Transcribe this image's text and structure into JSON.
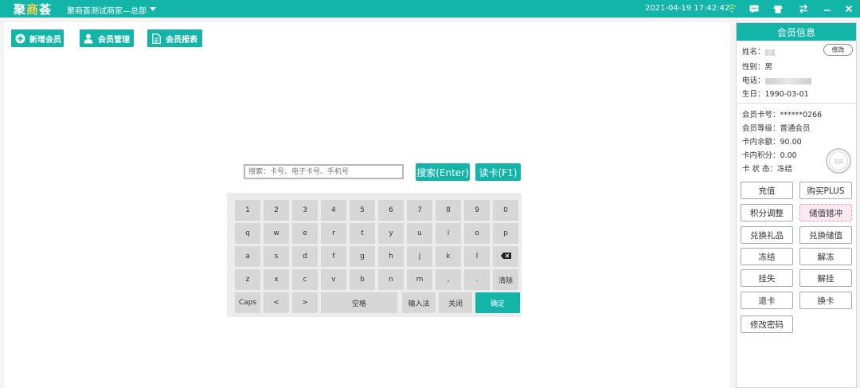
{
  "titlebar": {
    "logo_a": "聚",
    "logo_b": "商",
    "logo_c": "荟",
    "store_name": "聚商荟测试商家—总部",
    "datetime": "2021-04-19 17:42:42",
    "icons": [
      "wifi-icon",
      "message-icon",
      "shirt-icon",
      "swap-icon",
      "minimize-icon",
      "close-icon"
    ],
    "accent_color": "#13b5a8"
  },
  "toolbar": {
    "add_member": "新增会员",
    "member_manage": "会员管理",
    "member_report": "会员报表"
  },
  "search": {
    "placeholder": "搜索：卡号、电子卡号、手机号",
    "search_btn": "搜索(Enter)",
    "read_card_btn": "读卡(F1)"
  },
  "keyboard": {
    "row1": [
      "1",
      "2",
      "3",
      "4",
      "5",
      "6",
      "7",
      "8",
      "9",
      "0"
    ],
    "row2": [
      "q",
      "w",
      "e",
      "r",
      "t",
      "y",
      "u",
      "i",
      "o",
      "p"
    ],
    "row3": [
      "a",
      "s",
      "d",
      "f",
      "g",
      "h",
      "j",
      "k",
      "l"
    ],
    "row4": [
      "z",
      "x",
      "c",
      "v",
      "b",
      "n",
      "m",
      ",",
      ".",
      "清除"
    ],
    "row5": [
      "Caps",
      "<",
      ">",
      "空格",
      "输入法",
      "关闭",
      "确定"
    ]
  },
  "member": {
    "panel_title": "会员信息",
    "name_label": "姓名：",
    "edit_btn": "修改",
    "gender_label": "性别：",
    "gender": "男",
    "phone_label": "电话：",
    "birthday_label": "生日：",
    "birthday": "1990-03-01",
    "card_no_label": "会员卡号：",
    "card_no": "******0266",
    "level_label": "会员等级：",
    "level": "普通会员",
    "balance_label": "卡内余额：",
    "balance": "90.00",
    "points_label": "卡内积分：",
    "points": "0.00",
    "status_label": "卡 状 态：",
    "status": "冻结",
    "stamp_text": "冻结"
  },
  "actions": {
    "recharge": "充值",
    "buy_plus": "购买PLUS",
    "points_adjust": "积分调整",
    "reverse_stored": "储值错冲",
    "redeem_gift": "兑换礼品",
    "redeem_stored": "兑换储值",
    "freeze": "冻结",
    "unfreeze": "解冻",
    "report_loss": "挂失",
    "cancel_loss": "解挂",
    "return_card": "退卡",
    "replace_card": "换卡",
    "change_password": "修改密码"
  }
}
